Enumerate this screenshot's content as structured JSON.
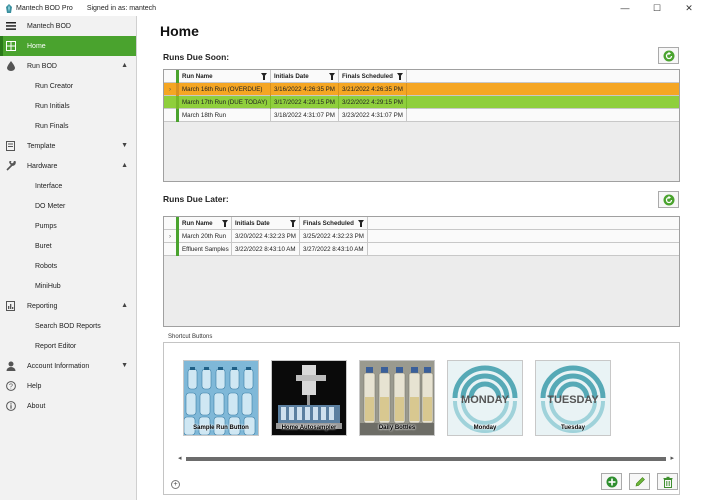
{
  "window": {
    "app_title": "Mantech BOD Pro",
    "signed_in": "Signed in as: mantech",
    "controls": [
      "—",
      "☐",
      "✕"
    ]
  },
  "sidebar": {
    "header": "Mantech BOD",
    "items": [
      {
        "label": "Home",
        "icon": "grid-icon",
        "active": true
      },
      {
        "label": "Run BOD",
        "icon": "drop-icon",
        "chevron": "▲",
        "children": [
          "Run Creator",
          "Run Initials",
          "Run Finals"
        ]
      },
      {
        "label": "Template",
        "icon": "template-icon",
        "chevron": "▼"
      },
      {
        "label": "Hardware",
        "icon": "wrench-icon",
        "chevron": "▲",
        "children": [
          "Interface",
          "DO Meter",
          "Pumps",
          "Buret",
          "Robots",
          "MiniHub"
        ]
      },
      {
        "label": "Reporting",
        "icon": "report-icon",
        "chevron": "▲",
        "children": [
          "Search BOD Reports",
          "Report Editor"
        ]
      },
      {
        "label": "Account Information",
        "icon": "user-icon",
        "chevron": "▼"
      },
      {
        "label": "Help",
        "icon": "help-icon"
      },
      {
        "label": "About",
        "icon": "info-icon"
      }
    ]
  },
  "main": {
    "title": "Home",
    "runs_due_soon": {
      "title": "Runs Due Soon:",
      "columns": [
        "Run Name",
        "Initials Date",
        "Finals Scheduled"
      ],
      "rows": [
        {
          "name": "March 16th Run (OVERDUE)",
          "initials": "3/16/2022 4:26:35 PM",
          "finals": "3/21/2022 4:26:35 PM",
          "status": "overdue"
        },
        {
          "name": "March 17th Run (DUE TODAY)",
          "initials": "3/17/2022 4:29:15 PM",
          "finals": "3/22/2022 4:29:15 PM",
          "status": "today"
        },
        {
          "name": "March 18th Run",
          "initials": "3/18/2022 4:31:07 PM",
          "finals": "3/23/2022 4:31:07 PM",
          "status": "normal"
        }
      ]
    },
    "runs_due_later": {
      "title": "Runs Due Later:",
      "columns": [
        "Run Name",
        "Initials Date",
        "Finals Scheduled"
      ],
      "rows": [
        {
          "name": "March 20th Run",
          "initials": "3/20/2022 4:32:23 PM",
          "finals": "3/25/2022 4:32:23 PM"
        },
        {
          "name": "Effluent Samples",
          "initials": "3/22/2022 8:43:10 AM",
          "finals": "3/27/2022 8:43:10 AM"
        }
      ]
    },
    "shortcuts": {
      "legend": "Shortcut Buttons",
      "items": [
        {
          "label": "Sample Run Button",
          "image": "bottles-rack"
        },
        {
          "label": "Home Autosampler",
          "image": "autosampler"
        },
        {
          "label": "Daily Bottles",
          "image": "bottle-row"
        },
        {
          "label": "Monday",
          "image": "swirl",
          "overlay": "MONDAY"
        },
        {
          "label": "Tuesday",
          "image": "swirl",
          "overlay": "TUESDAY"
        }
      ]
    },
    "colors": {
      "accent": "#4aa32e",
      "overdue": "#f5a623",
      "today": "#8fcf3c"
    }
  }
}
